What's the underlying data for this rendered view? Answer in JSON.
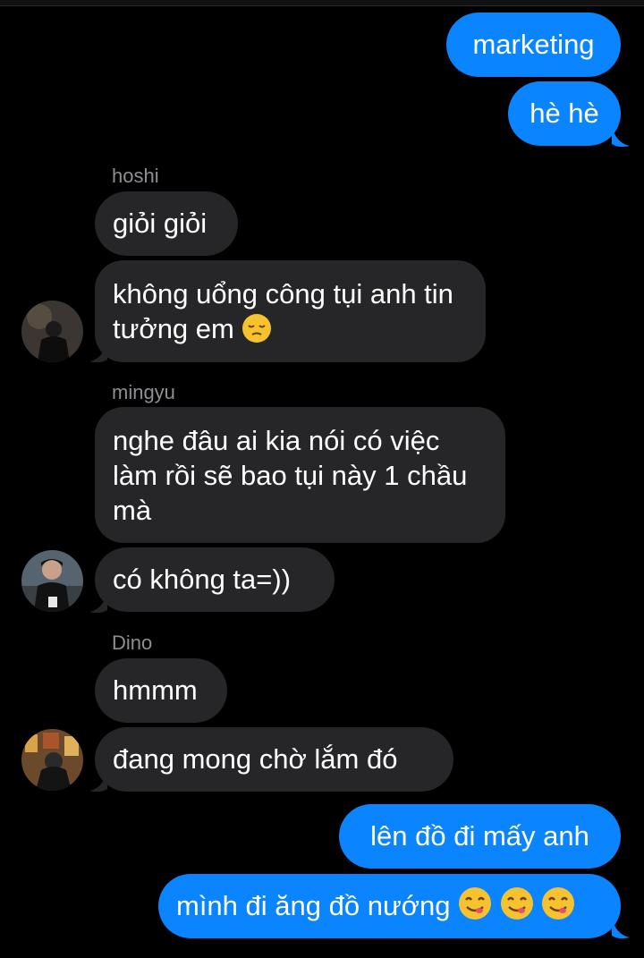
{
  "colors": {
    "background": "#000000",
    "outgoing": "#0a84ff",
    "incoming": "#262628",
    "sender_name": "#8e8e93"
  },
  "messages": {
    "out1": "marketing",
    "out2": "hè hè",
    "hoshi_name": "hoshi",
    "hoshi1": "giỏi giỏi",
    "hoshi2_text": "không uổng công tụi anh tin tưởng em",
    "hoshi2_emoji": "pensive-emoji",
    "mingyu_name": "mingyu",
    "mingyu1": "nghe đâu ai kia nói có việc làm rồi sẽ bao tụi này 1 chầu mà",
    "mingyu2": "có không ta=))",
    "dino_name": "Dino",
    "dino1": "hmmm",
    "dino2": "đang mong chờ lắm đó",
    "out3": "lên đồ đi mấy anh",
    "out4_text": "mình đi ăng đồ nướng",
    "out4_emoji": "yum-emoji"
  }
}
